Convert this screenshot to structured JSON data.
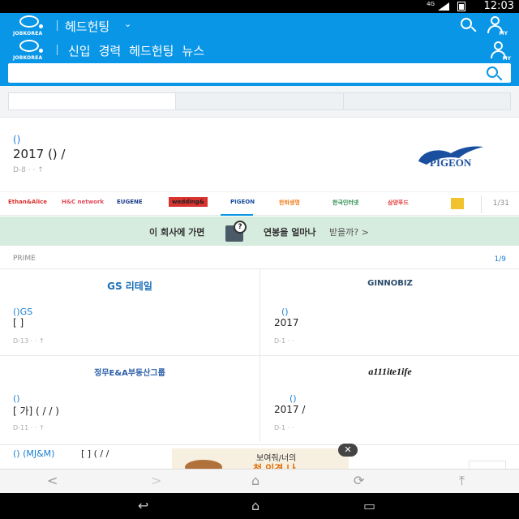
{
  "status_bar": {
    "network": "4G",
    "time": "12:03"
  },
  "header": {
    "logo_text": "JOBKOREA",
    "title": "헤드헌팅",
    "chevron": "⌄",
    "my_label": "MY"
  },
  "sub_header": {
    "logo_text": "JOBKOREA",
    "nav": [
      "신입",
      "경력",
      "헤드헌팅",
      "뉴스"
    ],
    "my_label": "MY"
  },
  "search": {
    "value": "",
    "placeholder": ""
  },
  "featured": {
    "company": "()",
    "title": "2017 ()        /",
    "meta": "D-8 ·  · ↑",
    "logo_text": "PIGEON"
  },
  "logo_strip": {
    "logos": [
      {
        "text": "Ethan&Alice",
        "color": "#d8332f"
      },
      {
        "text": "H&C network",
        "color": "#e24a5c"
      },
      {
        "text": "EUGENE",
        "color": "#1d3f8c"
      },
      {
        "text": "wedding&",
        "color": "#ffffff"
      },
      {
        "text": "PIGEON",
        "color": "#1a4fa0"
      },
      {
        "text": "한화생명",
        "color": "#f07d1a"
      },
      {
        "text": "한국인터넷",
        "color": "#2b8c4e"
      },
      {
        "text": "삼양푸드",
        "color": "#e03a3a"
      },
      {
        "text": "",
        "color": "#f2c12e"
      }
    ],
    "pager": "1/31"
  },
  "banner": {
    "left": "이 회사에 가면",
    "right_bold": "연봉을 얼마나",
    "right_rest": "받을까?  >"
  },
  "prime": {
    "label": "PRIME",
    "pager": "1/9",
    "cards": [
      {
        "logo": "GS 리테일",
        "company": "()GS",
        "title": "[ ]",
        "meta": "D-13 ·  · ↑"
      },
      {
        "logo": "GINNOBIZ",
        "company": "()",
        "title": "2017",
        "meta": "D-1 ·  ·"
      },
      {
        "logo": "정무E&A부동산그룹",
        "company": "()",
        "title": "[ 가]        ( / /   )",
        "meta": "D-11 ·  · ↑"
      },
      {
        "logo": "a111ite1ife",
        "company": "()",
        "title": "2017     /",
        "meta": "D-1 ·  ·"
      }
    ]
  },
  "peek_row": {
    "company": "()    (MJ&M)",
    "title": "[ ]        (   /   /"
  },
  "ad": {
    "line1": "보여줘/너의",
    "line2": "첫 인경 나",
    "close": "✕"
  },
  "bottom_nav": {
    "back": "<",
    "forward": ">",
    "home": "⌂",
    "refresh": "⟳",
    "top": "⤒"
  },
  "system_nav": {
    "back": "↩",
    "home": "⌂",
    "recents": "▭"
  }
}
